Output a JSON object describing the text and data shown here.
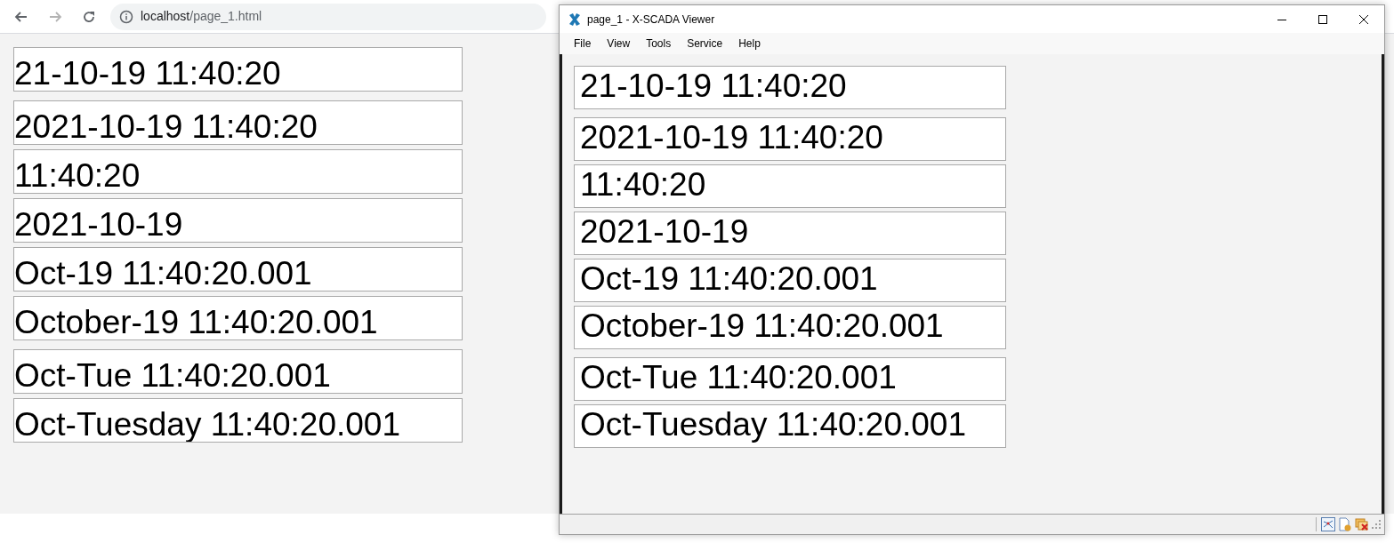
{
  "browser": {
    "nav": [
      {
        "kind": "back",
        "disabled": false
      },
      {
        "kind": "forward",
        "disabled": true
      },
      {
        "kind": "reload",
        "disabled": false
      }
    ],
    "address": {
      "host": "localhost",
      "path": "/page_1.html"
    }
  },
  "page_fields": [
    "21-10-19 11:40:20",
    "2021-10-19 11:40:20",
    "11:40:20",
    "2021-10-19",
    "Oct-19 11:40:20.001",
    "October-19 11:40:20.001",
    "Oct-Tue 11:40:20.001",
    "Oct-Tuesday 11:40:20.001"
  ],
  "viewer": {
    "title": "page_1 - X-SCADA Viewer",
    "menu": [
      "File",
      "View",
      "Tools",
      "Service",
      "Help"
    ],
    "fields": [
      "21-10-19 11:40:20",
      "2021-10-19 11:40:20",
      "11:40:20",
      "2021-10-19",
      "Oct-19 11:40:20.001",
      "October-19 11:40:20.001",
      "Oct-Tue 11:40:20.001",
      "Oct-Tuesday 11:40:20.001"
    ]
  }
}
